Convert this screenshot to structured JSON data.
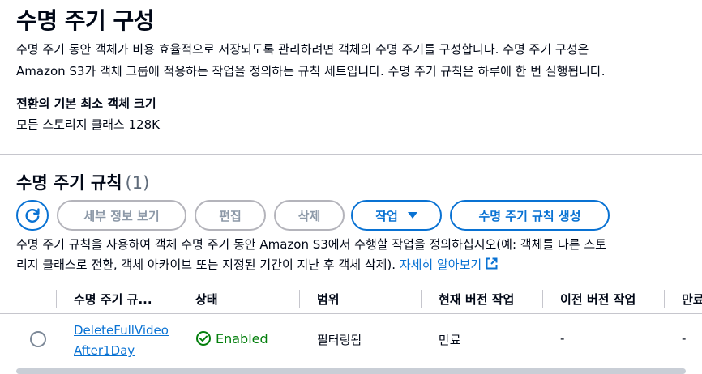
{
  "config": {
    "title": "수명 주기 구성",
    "description_line1": "수명 주기 동안 객체가 비용 효율적으로 저장되도록 관리하려면 객체의 수명 주기를 구성합니다. 수명 주기 구성은",
    "description_line2": "Amazon S3가 객체 그룹에 적용하는 작업을 정의하는 규칙 세트입니다. 수명 주기 규칙은 하루에 한 번 실행됩니다.",
    "min_size_label": "전환의 기본 최소 객체 크기",
    "min_size_value": "모든 스토리지 클래스 128K"
  },
  "rules": {
    "title": "수명 주기 규칙",
    "count": "(1)",
    "buttons": {
      "refresh_icon": "refresh-icon",
      "view_details": "세부 정보 보기",
      "edit": "편집",
      "delete": "삭제",
      "actions": "작업",
      "create": "수명 주기 규칙 생성"
    },
    "help_line1": "수명 주기 규칙을 사용하여 객체 수명 주기 동안 Amazon S3에서 수행할 작업을 정의하십시오(예: 객체를 다른 스토",
    "help_line2": "리지 클래스로 전환, 객체 아카이브 또는 지정된 기간이 지난 후 객체 삭제).",
    "learn_more": "자세히 알아보기",
    "columns": [
      "수명 주기 규...",
      "상태",
      "범위",
      "현재 버전 작업",
      "이전 버전 작업",
      "만료"
    ],
    "rows": [
      {
        "name": "DeleteFullVideoAfter1Day",
        "status": "Enabled",
        "scope": "필터링됨",
        "current_version_action": "만료",
        "previous_version_action": "-",
        "expiration": "-"
      }
    ]
  },
  "colors": {
    "accent": "#0972d3",
    "success": "#037f0c",
    "disabled": "#8d99a8"
  }
}
